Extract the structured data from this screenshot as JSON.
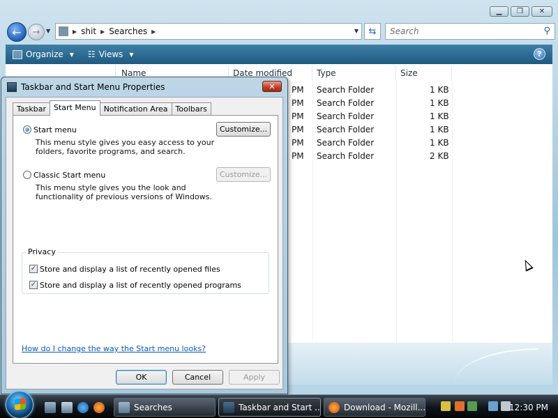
{
  "explorer": {
    "breadcrumb": [
      "shit",
      "Searches"
    ],
    "search_placeholder": "Search",
    "toolbar": {
      "organize": "Organize",
      "views": "Views"
    },
    "columns": {
      "name": "Name",
      "date_modified": "Date modified",
      "type": "Type",
      "size": "Size"
    },
    "rows": [
      {
        "date_suffix": "PM",
        "type": "Search Folder",
        "size": "1 KB"
      },
      {
        "date_suffix": "PM",
        "type": "Search Folder",
        "size": "1 KB"
      },
      {
        "date_suffix": "PM",
        "type": "Search Folder",
        "size": "1 KB"
      },
      {
        "date_suffix": "PM",
        "type": "Search Folder",
        "size": "1 KB"
      },
      {
        "date_suffix": "PM",
        "type": "Search Folder",
        "size": "1 KB"
      },
      {
        "date_suffix": "PM",
        "type": "Search Folder",
        "size": "2 KB"
      }
    ]
  },
  "dialog": {
    "title": "Taskbar and Start Menu Properties",
    "tabs": [
      "Taskbar",
      "Start Menu",
      "Notification Area",
      "Toolbars"
    ],
    "active_tab": "Start Menu",
    "start_menu": {
      "label": "Start menu",
      "selected": true,
      "desc1": "This menu style gives you easy access to your",
      "desc2": "folders, favorite programs, and search.",
      "customize": "Customize..."
    },
    "classic_menu": {
      "label": "Classic Start menu",
      "selected": false,
      "desc1": "This menu style gives you the look and",
      "desc2": "functionality of previous versions of Windows.",
      "customize": "Customize..."
    },
    "privacy": {
      "title": "Privacy",
      "files": "Store and display a list of recently opened files",
      "programs": "Store and display a list of recently opened programs",
      "files_checked": true,
      "programs_checked": true
    },
    "help_link": "How do I change the way the Start menu looks?",
    "buttons": {
      "ok": "OK",
      "cancel": "Cancel",
      "apply": "Apply"
    }
  },
  "taskbar": {
    "tasks": [
      "Searches",
      "Taskbar and Start ...",
      "Download - Mozill..."
    ],
    "clock": "12:30 PM"
  },
  "colors": {
    "toolbar": "#2a6a92",
    "link": "#0b59b5",
    "close_red": "#c1452d"
  }
}
